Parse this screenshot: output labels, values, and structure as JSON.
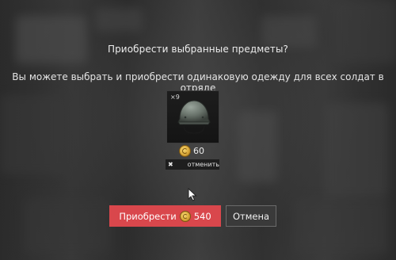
{
  "dialog": {
    "title": "Приобрести выбранные предметы?",
    "subtitle": "Вы можете выбрать и приобрести одинаковую одежду для всех солдат в отряде"
  },
  "item": {
    "count": "×9",
    "icon": "helmet-icon",
    "price": "60",
    "price_icon": "gold-coin-icon",
    "cancel_icon": "close-icon",
    "cancel_label": "отменить"
  },
  "actions": {
    "buy_label": "Приобрести",
    "buy_amount": "540",
    "buy_color": "#d9474c",
    "cancel_label": "Отмена"
  }
}
